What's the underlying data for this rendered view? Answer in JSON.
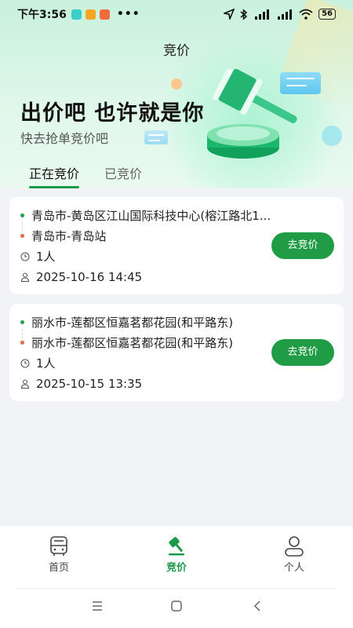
{
  "status_bar": {
    "time": "下午3:56",
    "dots": "•••",
    "battery": "56",
    "app_colors": [
      "#3ccfc9",
      "#f5a623",
      "#f26b3a"
    ]
  },
  "page": {
    "title": "竞价",
    "slogan": "出价吧 也许就是你",
    "sub_slogan": "快去抢单竞价吧"
  },
  "tabs": [
    {
      "label": "正在竞价",
      "active": true
    },
    {
      "label": "已竞价",
      "active": false
    }
  ],
  "orders": [
    {
      "from": "青岛市-黄岛区江山国际科技中心(榕江路北1...",
      "to": "青岛市-青岛站",
      "people": "1人",
      "datetime": "2025-10-16 14:45",
      "button": "去竞价"
    },
    {
      "from": "丽水市-莲都区恒嘉茗都花园(和平路东)",
      "to": "丽水市-莲都区恒嘉茗都花园(和平路东)",
      "people": "1人",
      "datetime": "2025-10-15 13:35",
      "button": "去竞价"
    }
  ],
  "bottom_nav": [
    {
      "label": "首页",
      "icon": "bus-icon",
      "active": false
    },
    {
      "label": "竞价",
      "icon": "gavel-icon",
      "active": true
    },
    {
      "label": "个人",
      "icon": "person-icon",
      "active": false
    }
  ],
  "colors": {
    "accent": "#1f9c45",
    "origin_dot": "#22a049",
    "destination_dot": "#ec6a4b"
  }
}
